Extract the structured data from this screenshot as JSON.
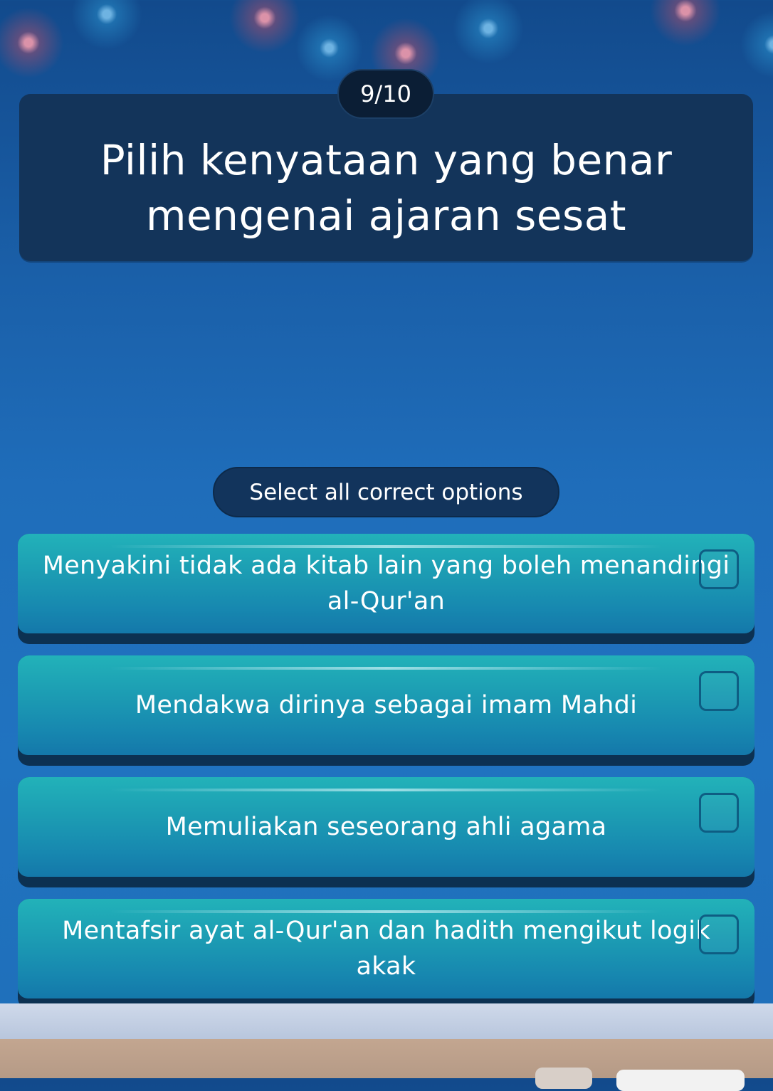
{
  "quiz": {
    "progress": "9/10",
    "question": "Pilih kenyataan yang benar mengenai ajaran sesat",
    "instruction": "Select all correct options",
    "options": [
      {
        "label": "Menyakini tidak ada kitab lain yang boleh menandingi al-Qur'an",
        "checked": false
      },
      {
        "label": "Mendakwa dirinya sebagai imam Mahdi",
        "checked": false
      },
      {
        "label": "Memuliakan seseorang ahli agama",
        "checked": false
      },
      {
        "label": "Mentafsir ayat al-Qur'an dan hadith mengikut logik akak",
        "checked": false
      }
    ]
  },
  "theme": {
    "background": "#1f6dba",
    "card": "#13345a",
    "option_teal": "#1c9cb3",
    "option_shadow": "#0c3152"
  }
}
